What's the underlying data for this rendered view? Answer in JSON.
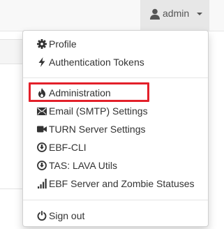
{
  "navbar": {
    "user_label": "admin",
    "user_icon": "user-icon",
    "caret_icon": "caret-down-icon"
  },
  "dropdown": {
    "groups": [
      [
        {
          "label": "Profile",
          "icon": "gear-icon"
        },
        {
          "label": "Authentication Tokens",
          "icon": "flash-icon"
        }
      ],
      [
        {
          "label": "Administration",
          "icon": "fire-icon",
          "highlighted": true
        },
        {
          "label": "Email (SMTP) Settings",
          "icon": "envelope-icon"
        },
        {
          "label": "TURN Server Settings",
          "icon": "video-camera-icon"
        },
        {
          "label": "EBF-CLI",
          "icon": "download-circle-icon"
        },
        {
          "label": "TAS: LAVA Utils",
          "icon": "download-circle-icon"
        },
        {
          "label": "EBF Server and Zombie Statuses",
          "icon": "signal-bars-icon"
        }
      ],
      [
        {
          "label": "Sign out",
          "icon": "power-icon"
        }
      ]
    ]
  },
  "colors": {
    "highlight_border": "#e3202a",
    "toggle_bg": "#e7e7e7",
    "text": "#333333"
  }
}
